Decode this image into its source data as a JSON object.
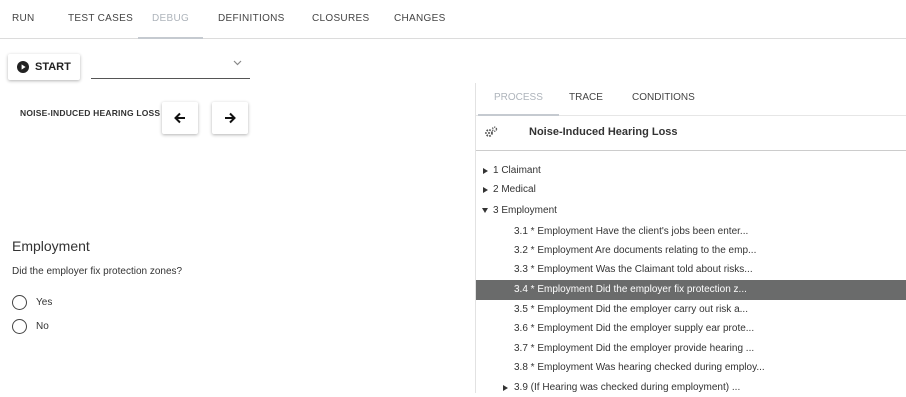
{
  "tabs": [
    {
      "label": "RUN",
      "active": false
    },
    {
      "label": "TEST CASES",
      "active": false
    },
    {
      "label": "DEBUG",
      "active": true
    },
    {
      "label": "DEFINITIONS",
      "active": false
    },
    {
      "label": "CLOSURES",
      "active": false
    },
    {
      "label": "CHANGES",
      "active": false
    }
  ],
  "toolbar": {
    "start_label": "START",
    "select_value": ""
  },
  "topic": {
    "title": "NOISE-INDUCED HEARING LOSS"
  },
  "question": {
    "section": "Employment",
    "text": "Did the employer fix protection zones?",
    "options": [
      "Yes",
      "No"
    ]
  },
  "right_panel": {
    "tabs": [
      {
        "label": "PROCESS",
        "active": true
      },
      {
        "label": "TRACE",
        "active": false
      },
      {
        "label": "CONDITIONS",
        "active": false
      }
    ],
    "process_title": "Noise-Induced Hearing Loss",
    "tree": [
      {
        "label": "1 Claimant",
        "level": 0,
        "expander": "collapsed"
      },
      {
        "label": "2 Medical",
        "level": 0,
        "expander": "collapsed"
      },
      {
        "label": "3 Employment",
        "level": 0,
        "expander": "expanded"
      },
      {
        "label": "3.1 * Employment Have the client's jobs been enter...",
        "level": 1
      },
      {
        "label": "3.2 * Employment Are documents relating to the emp...",
        "level": 1
      },
      {
        "label": "3.3 * Employment Was the Claimant told about risks...",
        "level": 1
      },
      {
        "label": "3.4 * Employment Did the employer fix protection z...",
        "level": 1,
        "selected": true
      },
      {
        "label": "3.5 * Employment Did the employer carry out risk a...",
        "level": 1
      },
      {
        "label": "3.6 * Employment Did the employer supply ear prote...",
        "level": 1
      },
      {
        "label": "3.7 * Employment Did the employer provide hearing ...",
        "level": 1
      },
      {
        "label": "3.8 * Employment Was hearing checked during employ...",
        "level": 1
      },
      {
        "label": "3.9 (If Hearing was checked during employment) ...",
        "level": 1,
        "expander": "collapsed"
      }
    ]
  },
  "colors": {
    "selected_row": "#6a6b6b",
    "inactive_tab": "#aeb4bb"
  }
}
